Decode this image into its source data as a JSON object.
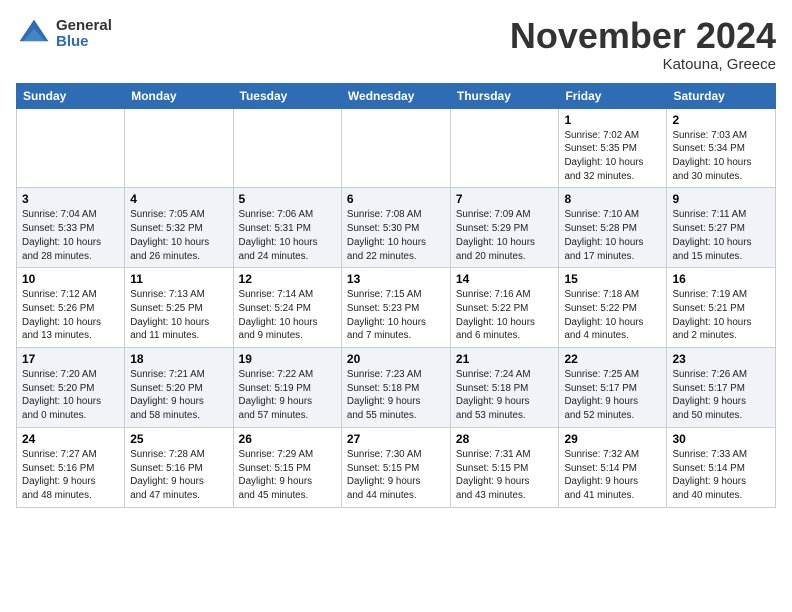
{
  "header": {
    "logo_general": "General",
    "logo_blue": "Blue",
    "month_title": "November 2024",
    "location": "Katouna, Greece"
  },
  "weekdays": [
    "Sunday",
    "Monday",
    "Tuesday",
    "Wednesday",
    "Thursday",
    "Friday",
    "Saturday"
  ],
  "weeks": [
    [
      {
        "day": "",
        "info": ""
      },
      {
        "day": "",
        "info": ""
      },
      {
        "day": "",
        "info": ""
      },
      {
        "day": "",
        "info": ""
      },
      {
        "day": "",
        "info": ""
      },
      {
        "day": "1",
        "info": "Sunrise: 7:02 AM\nSunset: 5:35 PM\nDaylight: 10 hours\nand 32 minutes."
      },
      {
        "day": "2",
        "info": "Sunrise: 7:03 AM\nSunset: 5:34 PM\nDaylight: 10 hours\nand 30 minutes."
      }
    ],
    [
      {
        "day": "3",
        "info": "Sunrise: 7:04 AM\nSunset: 5:33 PM\nDaylight: 10 hours\nand 28 minutes."
      },
      {
        "day": "4",
        "info": "Sunrise: 7:05 AM\nSunset: 5:32 PM\nDaylight: 10 hours\nand 26 minutes."
      },
      {
        "day": "5",
        "info": "Sunrise: 7:06 AM\nSunset: 5:31 PM\nDaylight: 10 hours\nand 24 minutes."
      },
      {
        "day": "6",
        "info": "Sunrise: 7:08 AM\nSunset: 5:30 PM\nDaylight: 10 hours\nand 22 minutes."
      },
      {
        "day": "7",
        "info": "Sunrise: 7:09 AM\nSunset: 5:29 PM\nDaylight: 10 hours\nand 20 minutes."
      },
      {
        "day": "8",
        "info": "Sunrise: 7:10 AM\nSunset: 5:28 PM\nDaylight: 10 hours\nand 17 minutes."
      },
      {
        "day": "9",
        "info": "Sunrise: 7:11 AM\nSunset: 5:27 PM\nDaylight: 10 hours\nand 15 minutes."
      }
    ],
    [
      {
        "day": "10",
        "info": "Sunrise: 7:12 AM\nSunset: 5:26 PM\nDaylight: 10 hours\nand 13 minutes."
      },
      {
        "day": "11",
        "info": "Sunrise: 7:13 AM\nSunset: 5:25 PM\nDaylight: 10 hours\nand 11 minutes."
      },
      {
        "day": "12",
        "info": "Sunrise: 7:14 AM\nSunset: 5:24 PM\nDaylight: 10 hours\nand 9 minutes."
      },
      {
        "day": "13",
        "info": "Sunrise: 7:15 AM\nSunset: 5:23 PM\nDaylight: 10 hours\nand 7 minutes."
      },
      {
        "day": "14",
        "info": "Sunrise: 7:16 AM\nSunset: 5:22 PM\nDaylight: 10 hours\nand 6 minutes."
      },
      {
        "day": "15",
        "info": "Sunrise: 7:18 AM\nSunset: 5:22 PM\nDaylight: 10 hours\nand 4 minutes."
      },
      {
        "day": "16",
        "info": "Sunrise: 7:19 AM\nSunset: 5:21 PM\nDaylight: 10 hours\nand 2 minutes."
      }
    ],
    [
      {
        "day": "17",
        "info": "Sunrise: 7:20 AM\nSunset: 5:20 PM\nDaylight: 10 hours\nand 0 minutes."
      },
      {
        "day": "18",
        "info": "Sunrise: 7:21 AM\nSunset: 5:20 PM\nDaylight: 9 hours\nand 58 minutes."
      },
      {
        "day": "19",
        "info": "Sunrise: 7:22 AM\nSunset: 5:19 PM\nDaylight: 9 hours\nand 57 minutes."
      },
      {
        "day": "20",
        "info": "Sunrise: 7:23 AM\nSunset: 5:18 PM\nDaylight: 9 hours\nand 55 minutes."
      },
      {
        "day": "21",
        "info": "Sunrise: 7:24 AM\nSunset: 5:18 PM\nDaylight: 9 hours\nand 53 minutes."
      },
      {
        "day": "22",
        "info": "Sunrise: 7:25 AM\nSunset: 5:17 PM\nDaylight: 9 hours\nand 52 minutes."
      },
      {
        "day": "23",
        "info": "Sunrise: 7:26 AM\nSunset: 5:17 PM\nDaylight: 9 hours\nand 50 minutes."
      }
    ],
    [
      {
        "day": "24",
        "info": "Sunrise: 7:27 AM\nSunset: 5:16 PM\nDaylight: 9 hours\nand 48 minutes."
      },
      {
        "day": "25",
        "info": "Sunrise: 7:28 AM\nSunset: 5:16 PM\nDaylight: 9 hours\nand 47 minutes."
      },
      {
        "day": "26",
        "info": "Sunrise: 7:29 AM\nSunset: 5:15 PM\nDaylight: 9 hours\nand 45 minutes."
      },
      {
        "day": "27",
        "info": "Sunrise: 7:30 AM\nSunset: 5:15 PM\nDaylight: 9 hours\nand 44 minutes."
      },
      {
        "day": "28",
        "info": "Sunrise: 7:31 AM\nSunset: 5:15 PM\nDaylight: 9 hours\nand 43 minutes."
      },
      {
        "day": "29",
        "info": "Sunrise: 7:32 AM\nSunset: 5:14 PM\nDaylight: 9 hours\nand 41 minutes."
      },
      {
        "day": "30",
        "info": "Sunrise: 7:33 AM\nSunset: 5:14 PM\nDaylight: 9 hours\nand 40 minutes."
      }
    ]
  ]
}
